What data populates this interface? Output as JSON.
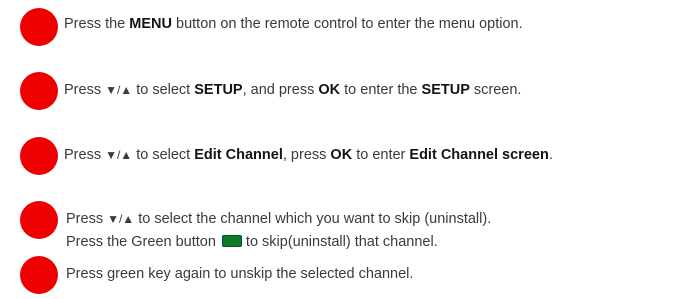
{
  "steps": [
    {
      "parts": [
        "Press the ",
        "MENU",
        " button on the remote control to enter the menu option."
      ]
    },
    {
      "parts": [
        "Press ",
        "▼/▲",
        " to select ",
        "SETUP",
        ", and press ",
        "OK",
        " to enter the ",
        "SETUP",
        " screen."
      ]
    },
    {
      "parts": [
        "Press ",
        "▼/▲",
        " to select ",
        "Edit Channel",
        ", press ",
        "OK",
        " to enter ",
        "Edit Channel screen",
        "."
      ]
    },
    {
      "line1": [
        "Press ",
        "▼/▲",
        " to select the channel which you want to skip (uninstall)."
      ],
      "line2": [
        "Press the Green button",
        "to skip(uninstall) that channel."
      ],
      "green_key_icon": "green-button-icon"
    },
    {
      "parts": [
        "Press green key again to unskip the selected channel."
      ]
    }
  ],
  "colors": {
    "bullet": "#ee0000",
    "green_key": "#0d7a2a"
  }
}
